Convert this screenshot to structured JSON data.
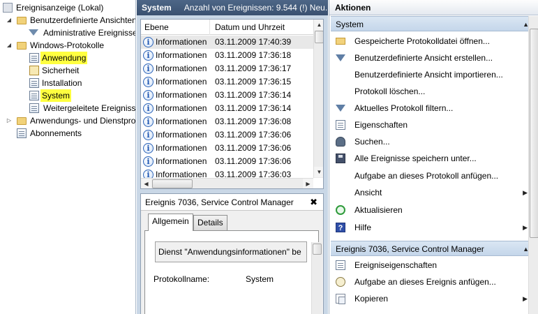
{
  "tree": {
    "root": "Ereignisanzeige (Lokal)",
    "custom_views": "Benutzerdefinierte Ansichten",
    "admin_events": "Administrative Ereignisse",
    "windows_logs": "Windows-Protokolle",
    "application": "Anwendung",
    "security": "Sicherheit",
    "setup": "Installation",
    "system": "System",
    "forwarded": "Weitergeleitete Ereignisse",
    "apps_services": "Anwendungs- und Dienstprotokolle",
    "subscriptions": "Abonnements",
    "highlight_color": "#ffff40"
  },
  "middle": {
    "title": "System",
    "count_text": "Anzahl von Ereignissen: 9.544 (!) Neu...",
    "col_level": "Ebene",
    "col_datetime": "Datum und Uhrzeit",
    "rows": [
      {
        "level": "Informationen",
        "datetime": "03.11.2009 17:40:39"
      },
      {
        "level": "Informationen",
        "datetime": "03.11.2009 17:36:18"
      },
      {
        "level": "Informationen",
        "datetime": "03.11.2009 17:36:17"
      },
      {
        "level": "Informationen",
        "datetime": "03.11.2009 17:36:15"
      },
      {
        "level": "Informationen",
        "datetime": "03.11.2009 17:36:14"
      },
      {
        "level": "Informationen",
        "datetime": "03.11.2009 17:36:14"
      },
      {
        "level": "Informationen",
        "datetime": "03.11.2009 17:36:08"
      },
      {
        "level": "Informationen",
        "datetime": "03.11.2009 17:36:06"
      },
      {
        "level": "Informationen",
        "datetime": "03.11.2009 17:36:06"
      },
      {
        "level": "Informationen",
        "datetime": "03.11.2009 17:36:06"
      },
      {
        "level": "Informationen",
        "datetime": "03.11.2009 17:36:03"
      }
    ],
    "info_glyph": "i"
  },
  "detail": {
    "title": "Ereignis 7036, Service Control Manager",
    "close": "✖",
    "tab_general": "Allgemein",
    "tab_details": "Details",
    "description": "Dienst \"Anwendungsinformationen\" be",
    "protocol_label": "Protokollname:",
    "protocol_value": "System"
  },
  "actions": {
    "header": "Aktionen",
    "section_system": "System",
    "items_system": [
      {
        "label": "Gespeicherte Protokolldatei öffnen...",
        "icon": "open-folder-icon"
      },
      {
        "label": "Benutzerdefinierte Ansicht erstellen...",
        "icon": "filter-icon"
      },
      {
        "label": "Benutzerdefinierte Ansicht importieren...",
        "icon": ""
      },
      {
        "label": "Protokoll löschen...",
        "icon": ""
      },
      {
        "label": "Aktuelles Protokoll filtern...",
        "icon": "filter-icon"
      },
      {
        "label": "Eigenschaften",
        "icon": "properties-icon"
      },
      {
        "label": "Suchen...",
        "icon": "binoculars-icon"
      },
      {
        "label": "Alle Ereignisse speichern unter...",
        "icon": "save-icon"
      },
      {
        "label": "Aufgabe an dieses Protokoll anfügen...",
        "icon": ""
      },
      {
        "label": "Ansicht",
        "icon": ""
      },
      {
        "label": "Aktualisieren",
        "icon": "refresh-icon"
      },
      {
        "label": "Hilfe",
        "icon": "help-icon"
      }
    ],
    "section_event": "Ereignis 7036, Service Control Manager",
    "items_event": [
      {
        "label": "Ereigniseigenschaften",
        "icon": "properties-icon"
      },
      {
        "label": "Aufgabe an dieses Ereignis anfügen...",
        "icon": "task-icon"
      },
      {
        "label": "Kopieren",
        "icon": "copy-icon"
      }
    ],
    "help_glyph": "?",
    "collapse_glyph": "▲",
    "submenu_glyph": "▶"
  }
}
